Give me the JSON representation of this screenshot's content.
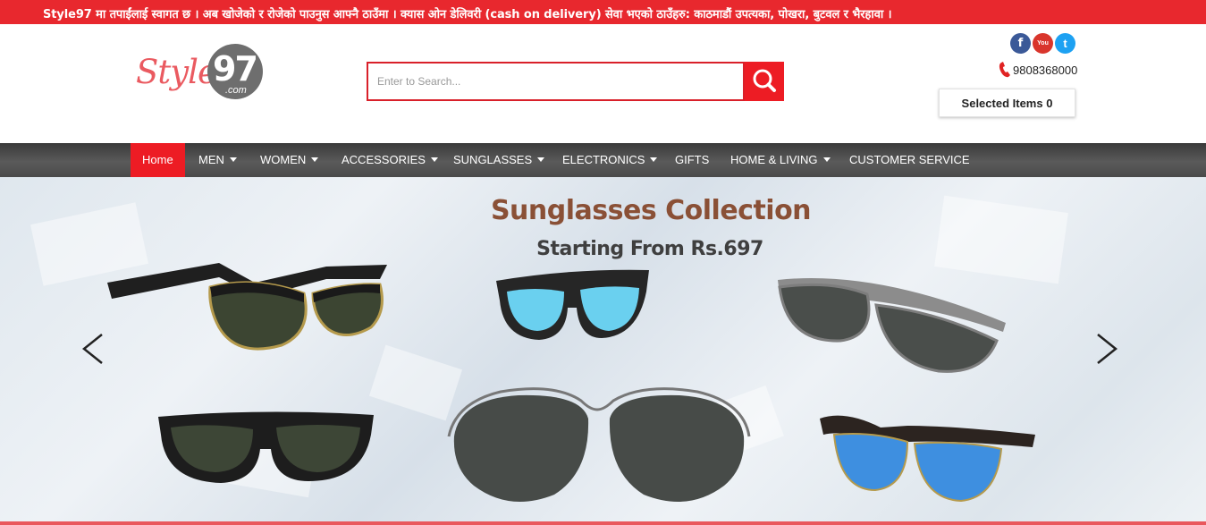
{
  "topbar": {
    "text": "Style97 मा तपाईंलाई स्वागत छ । अब खोजेको र रोजेको पाउनुस आफ्नै ठाउँमा । क्यास ओन डेलिवरी (cash on delivery) सेवा भएको ठाउँहरु: काठमाडौं उपत्यका, पोखरा, बुटवल र भैरहावा ।",
    "color": "#e8282e"
  },
  "logo": {
    "word": "Style",
    "number": "97",
    "suffix": ".com"
  },
  "search": {
    "placeholder": "Enter to Search...",
    "value": "",
    "button_icon": "search-icon"
  },
  "socials": [
    {
      "name": "facebook",
      "glyph": "f",
      "color": "#3b5998"
    },
    {
      "name": "youtube",
      "glyph": "You Tube",
      "color": "#d9352c"
    },
    {
      "name": "twitter",
      "glyph": "t",
      "color": "#1da1f2"
    }
  ],
  "contact": {
    "phone": "9808368000",
    "icon": "phone-icon"
  },
  "cart": {
    "label": "Selected Items 0"
  },
  "nav": {
    "items": [
      {
        "label": "Home",
        "active": true,
        "dropdown": false
      },
      {
        "label": "MEN",
        "active": false,
        "dropdown": true
      },
      {
        "label": "WOMEN",
        "active": false,
        "dropdown": true
      },
      {
        "label": "ACCESSORIES",
        "active": false,
        "dropdown": true
      },
      {
        "label": "SUNGLASSES",
        "active": false,
        "dropdown": true
      },
      {
        "label": "ELECTRONICS",
        "active": false,
        "dropdown": true
      },
      {
        "label": "GIFTS",
        "active": false,
        "dropdown": false
      },
      {
        "label": "HOME & LIVING",
        "active": false,
        "dropdown": true
      },
      {
        "label": "CUSTOMER SERVICE",
        "active": false,
        "dropdown": false
      }
    ]
  },
  "banner": {
    "title": "Sunglasses Collection",
    "subtitle": "Starting From Rs.697",
    "prev_icon": "chevron-left-icon",
    "next_icon": "chevron-right-icon"
  },
  "colors": {
    "accent": "#ed1c24",
    "nav_bg": "#4a4a4a",
    "title": "#8a5036"
  }
}
